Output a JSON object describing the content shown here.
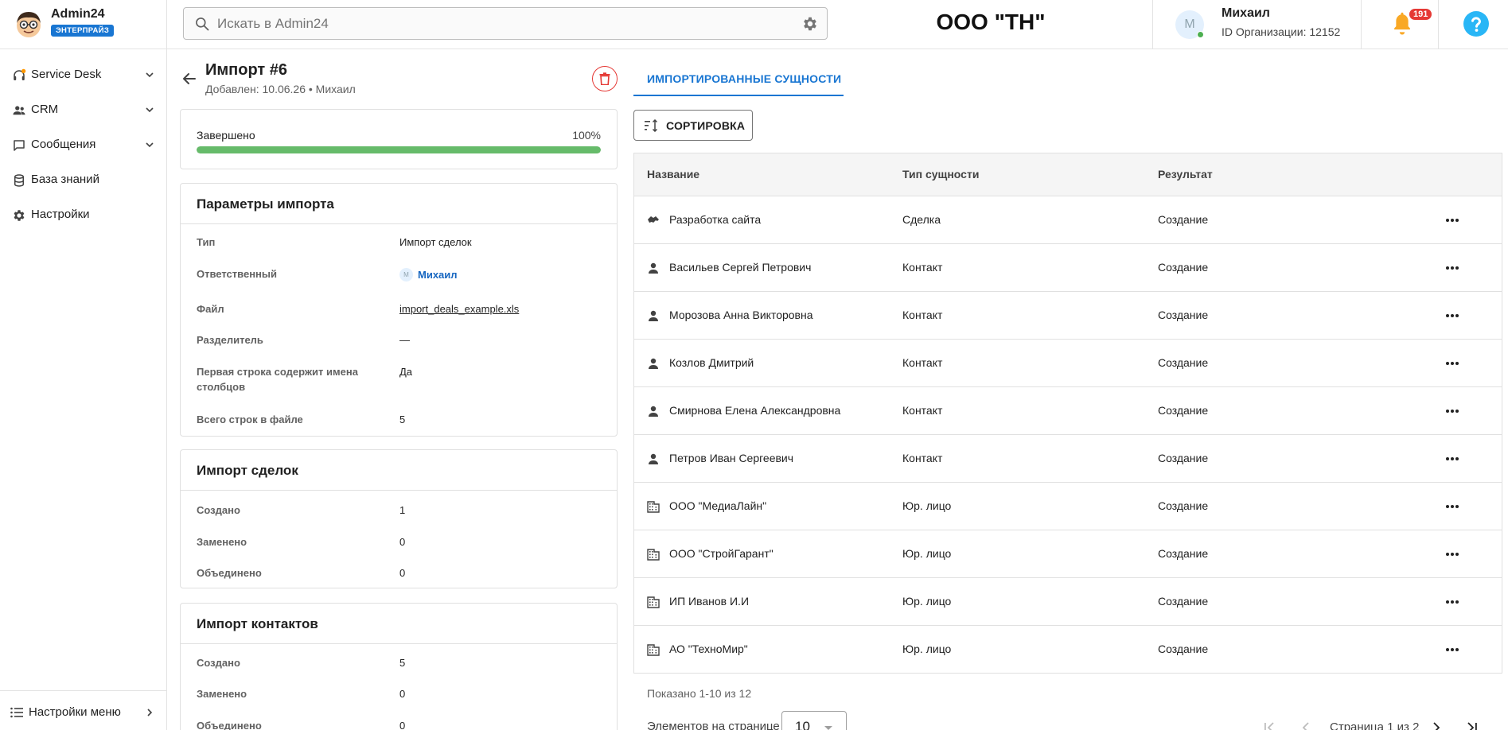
{
  "brand": {
    "name": "Admin24",
    "badge": "ЭНТЕРПРАЙЗ"
  },
  "search": {
    "placeholder": "Искать в Admin24"
  },
  "header": {
    "org_name": "ООО \"ТН\"",
    "user": {
      "initial": "М",
      "name": "Михаил",
      "org_id": "ID Организации: 12152"
    },
    "notifications_count": "191"
  },
  "sidebar": {
    "items": [
      {
        "label": "Service Desk",
        "icon": "headset-icon",
        "expandable": true
      },
      {
        "label": "CRM",
        "icon": "people-icon",
        "expandable": true
      },
      {
        "label": "Сообщения",
        "icon": "chat-icon",
        "expandable": true
      },
      {
        "label": "База знаний",
        "icon": "database-icon",
        "expandable": false
      },
      {
        "label": "Настройки",
        "icon": "gear-icon",
        "expandable": false
      }
    ],
    "footer_label": "Настройки меню"
  },
  "import": {
    "title": "Импорт #6",
    "subtitle": "Добавлен: 10.06.26 • Михаил",
    "status": "Завершено",
    "progress_percent": 100,
    "progress_text": "100%"
  },
  "params": {
    "heading": "Параметры импорта",
    "type_label": "Тип",
    "type_value": "Импорт сделок",
    "responsible_label": "Ответственный",
    "responsible_initial": "М",
    "responsible_value": "Михаил",
    "file_label": "Файл",
    "file_value": "import_deals_example.xls",
    "delimiter_label": "Разделитель",
    "delimiter_value": "—",
    "header_row_label": "Первая строка содержит имена столбцов",
    "header_row_value": "Да",
    "rows_label": "Всего строк в файле",
    "rows_value": "5"
  },
  "deals": {
    "heading": "Импорт сделок",
    "created_label": "Создано",
    "created_value": "1",
    "replaced_label": "Заменено",
    "replaced_value": "0",
    "merged_label": "Объединено",
    "merged_value": "0"
  },
  "contacts": {
    "heading": "Импорт контактов",
    "created_label": "Создано",
    "created_value": "5",
    "replaced_label": "Заменено",
    "replaced_value": "0",
    "merged_label": "Объединено",
    "merged_value": "0"
  },
  "entities": {
    "tab_label": "ИМПОРТИРОВАННЫЕ СУЩНОСТИ",
    "sort_label": "СОРТИРОВКА",
    "columns": [
      "Название",
      "Тип сущности",
      "Результат"
    ],
    "rows": [
      {
        "icon": "handshake-icon",
        "name": "Разработка сайта",
        "type": "Сделка",
        "result": "Создание"
      },
      {
        "icon": "person-icon",
        "name": "Васильев Сергей Петрович",
        "type": "Контакт",
        "result": "Создание"
      },
      {
        "icon": "person-icon",
        "name": "Морозова Анна Викторовна",
        "type": "Контакт",
        "result": "Создание"
      },
      {
        "icon": "person-icon",
        "name": "Козлов Дмитрий",
        "type": "Контакт",
        "result": "Создание"
      },
      {
        "icon": "person-icon",
        "name": "Смирнова Елена Александровна",
        "type": "Контакт",
        "result": "Создание"
      },
      {
        "icon": "person-icon",
        "name": "Петров Иван Сергеевич",
        "type": "Контакт",
        "result": "Создание"
      },
      {
        "icon": "building-icon",
        "name": "ООО \"МедиаЛайн\"",
        "type": "Юр. лицо",
        "result": "Создание"
      },
      {
        "icon": "building-icon",
        "name": "ООО \"СтройГарант\"",
        "type": "Юр. лицо",
        "result": "Создание"
      },
      {
        "icon": "building-icon",
        "name": "ИП Иванов И.И",
        "type": "Юр. лицо",
        "result": "Создание"
      },
      {
        "icon": "building-icon",
        "name": "АО \"ТехноМир\"",
        "type": "Юр. лицо",
        "result": "Создание"
      }
    ],
    "shown_text": "Показано 1-10 из 12",
    "per_page_label": "Элементов на странице",
    "per_page_value": "10",
    "page_text": "Страница 1 из 2"
  },
  "colors": {
    "accent": "#1976d2",
    "success": "#66bb6a",
    "danger": "#e53935",
    "warning": "#f9a825"
  }
}
